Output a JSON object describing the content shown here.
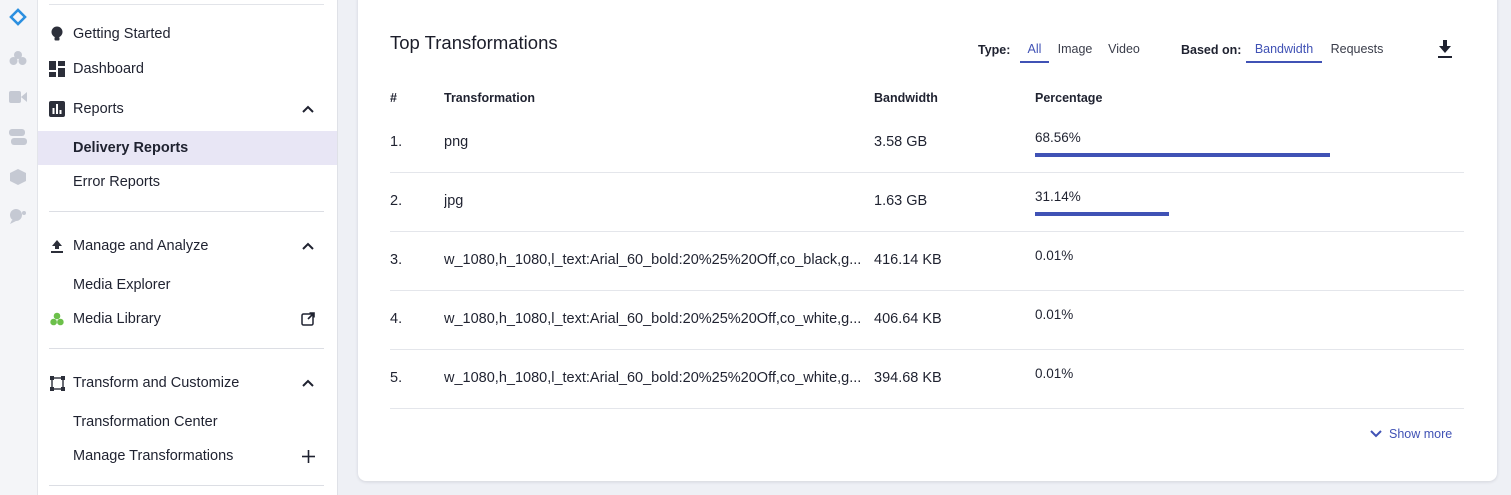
{
  "sidebar": {
    "getting_started": "Getting Started",
    "dashboard": "Dashboard",
    "reports": "Reports",
    "delivery_reports": "Delivery Reports",
    "error_reports": "Error Reports",
    "manage_analyze": "Manage and Analyze",
    "media_explorer": "Media Explorer",
    "media_library": "Media Library",
    "transform_customize": "Transform and Customize",
    "transformation_center": "Transformation Center",
    "manage_transformations": "Manage Transformations"
  },
  "card": {
    "title": "Top Transformations",
    "type_label": "Type:",
    "type_options": [
      "All",
      "Image",
      "Video"
    ],
    "type_selected": "All",
    "based_label": "Based on:",
    "based_options": [
      "Bandwidth",
      "Requests"
    ],
    "based_selected": "Bandwidth",
    "download_icon": "download-icon",
    "columns": [
      "#",
      "Transformation",
      "Bandwidth",
      "Percentage"
    ],
    "rows": [
      {
        "num": "1.",
        "name": "png",
        "bandwidth": "3.58 GB",
        "percent": "68.56%",
        "share": 68.56
      },
      {
        "num": "2.",
        "name": "jpg",
        "bandwidth": "1.63 GB",
        "percent": "31.14%",
        "share": 31.14
      },
      {
        "num": "3.",
        "name": "w_1080,h_1080,l_text:Arial_60_bold:20%25%20Off,co_black,g...",
        "bandwidth": "416.14 KB",
        "percent": "0.01%",
        "share": 0.01
      },
      {
        "num": "4.",
        "name": "w_1080,h_1080,l_text:Arial_60_bold:20%25%20Off,co_white,g...",
        "bandwidth": "406.64 KB",
        "percent": "0.01%",
        "share": 0.01
      },
      {
        "num": "5.",
        "name": "w_1080,h_1080,l_text:Arial_60_bold:20%25%20Off,co_white,g...",
        "bandwidth": "394.68 KB",
        "percent": "0.01%",
        "share": 0.01
      }
    ],
    "show_more": "Show more"
  },
  "colors": {
    "accent": "#4052b5",
    "active_bg": "#e8e6f5",
    "media_library_icon": "#6cc04a"
  }
}
